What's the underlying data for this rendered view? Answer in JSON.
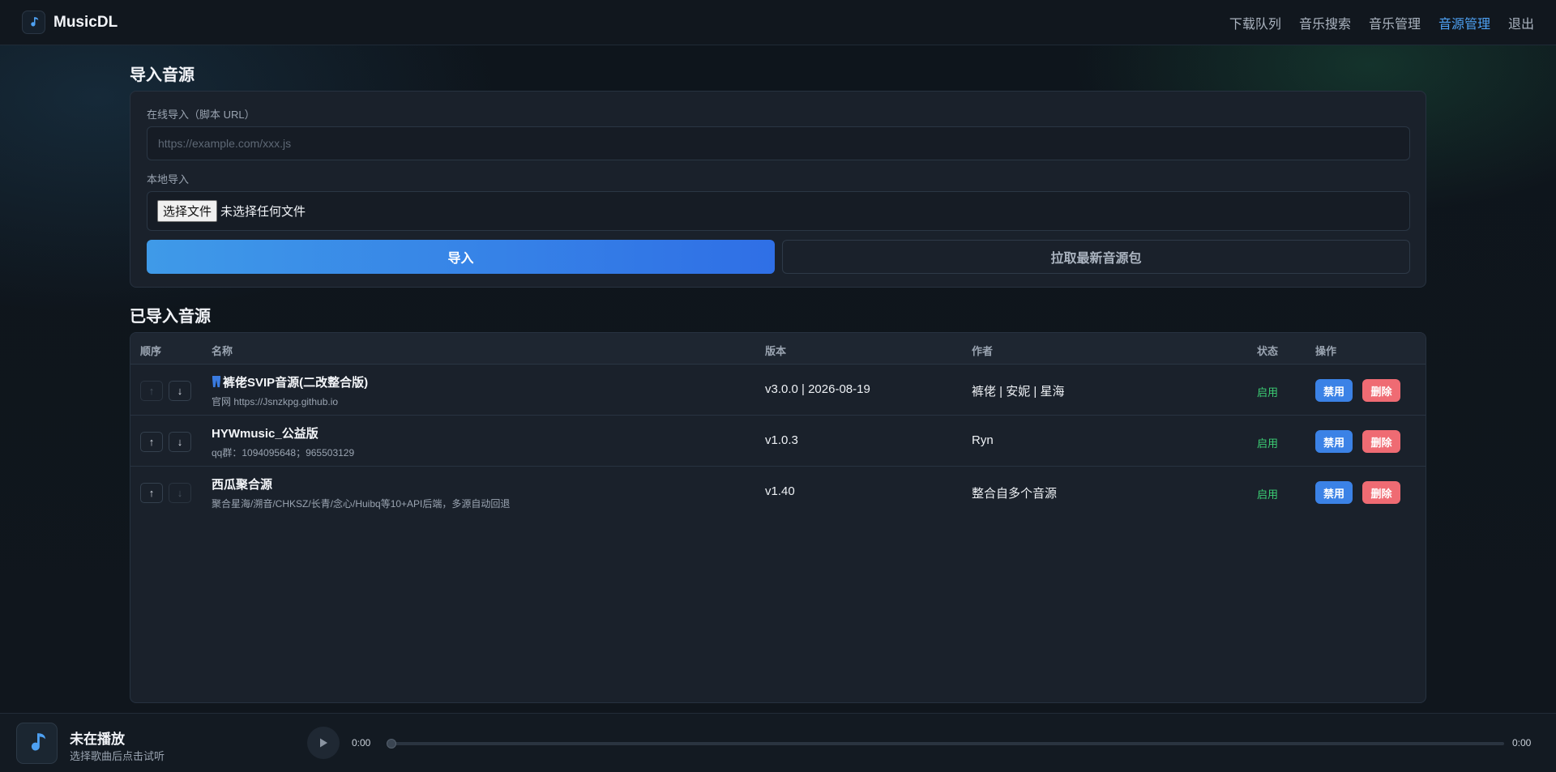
{
  "app": {
    "name": "MusicDL",
    "logo_icon": "music-note-icon"
  },
  "nav": [
    {
      "label": "下载队列",
      "active": false
    },
    {
      "label": "音乐搜索",
      "active": false
    },
    {
      "label": "音乐管理",
      "active": false
    },
    {
      "label": "音源管理",
      "active": true
    },
    {
      "label": "退出",
      "active": false
    }
  ],
  "import_section": {
    "title": "导入音源",
    "online_label": "在线导入（脚本 URL）",
    "url_placeholder": "https://example.com/xxx.js",
    "url_value": "",
    "local_label": "本地导入",
    "file_button": "选择文件",
    "file_status": "未选择任何文件",
    "import_button": "导入",
    "fetch_button": "拉取最新音源包"
  },
  "sources_section": {
    "title": "已导入音源",
    "columns": {
      "order": "顺序",
      "name": "名称",
      "version": "版本",
      "author": "作者",
      "status": "状态",
      "actions": "操作"
    },
    "up_arrow": "↑",
    "down_arrow": "↓",
    "rows": [
      {
        "name_icon": "blue-trousers-icon",
        "name": "裤佬SVIP音源(二改整合版)",
        "desc": "官网 https://Jsnzkpg.github.io",
        "version": "v3.0.0 | 2026-08-19",
        "author": "裤佬 | 安妮 | 星海",
        "status": "启用",
        "disable_label": "禁用",
        "delete_label": "删除",
        "up_enabled": false,
        "down_enabled": true
      },
      {
        "name_icon": "",
        "name": "HYWmusic_公益版",
        "desc": "qq群：1094095648；965503129",
        "version": "v1.0.3",
        "author": "Ryn",
        "status": "启用",
        "disable_label": "禁用",
        "delete_label": "删除",
        "up_enabled": true,
        "down_enabled": true
      },
      {
        "name_icon": "",
        "name": "西瓜聚合源",
        "desc": "聚合星海/溯音/CHKSZ/长青/念心/Huibq等10+API后端，多源自动回退",
        "version": "v1.40",
        "author": "整合自多个音源",
        "status": "启用",
        "disable_label": "禁用",
        "delete_label": "删除",
        "up_enabled": true,
        "down_enabled": false
      }
    ]
  },
  "player": {
    "title": "未在播放",
    "subtitle": "选择歌曲后点击试听",
    "current_time": "0:00",
    "total_time": "0:00",
    "progress": 0
  },
  "colors": {
    "accent": "#4ea1f3",
    "enabled_status": "#3ccf74",
    "disable_button": "#3b82e6",
    "delete_button": "#ef6b73"
  }
}
